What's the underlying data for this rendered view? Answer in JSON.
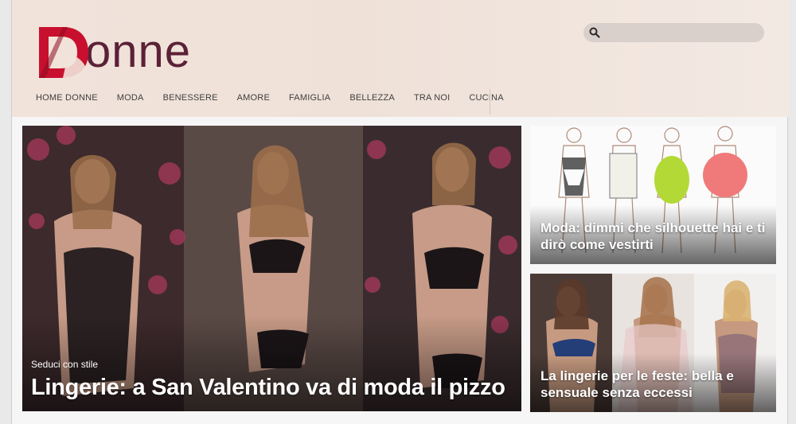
{
  "brand": {
    "logo_letter": "D",
    "logo_rest": "onne",
    "logo_color": "#5b2137",
    "accent": "#c8102e"
  },
  "search": {
    "placeholder": "",
    "value": "",
    "icon": "search-icon"
  },
  "nav": {
    "items": [
      {
        "label": "HOME DONNE"
      },
      {
        "label": "MODA"
      },
      {
        "label": "BENESSERE"
      },
      {
        "label": "AMORE"
      },
      {
        "label": "FAMIGLIA"
      },
      {
        "label": "BELLEZZA"
      },
      {
        "label": "TRA NOI"
      },
      {
        "label": "CUCINA"
      }
    ]
  },
  "featured": {
    "kicker": "Seduci con stile",
    "title": "Lingerie: a San Valentino va di moda il pizzo"
  },
  "side_articles": [
    {
      "title": "Moda: dimmi che silhouette hai e ti dirò come vestirti"
    },
    {
      "title": "La lingerie per le feste: bella e sensuale senza eccessi"
    }
  ]
}
